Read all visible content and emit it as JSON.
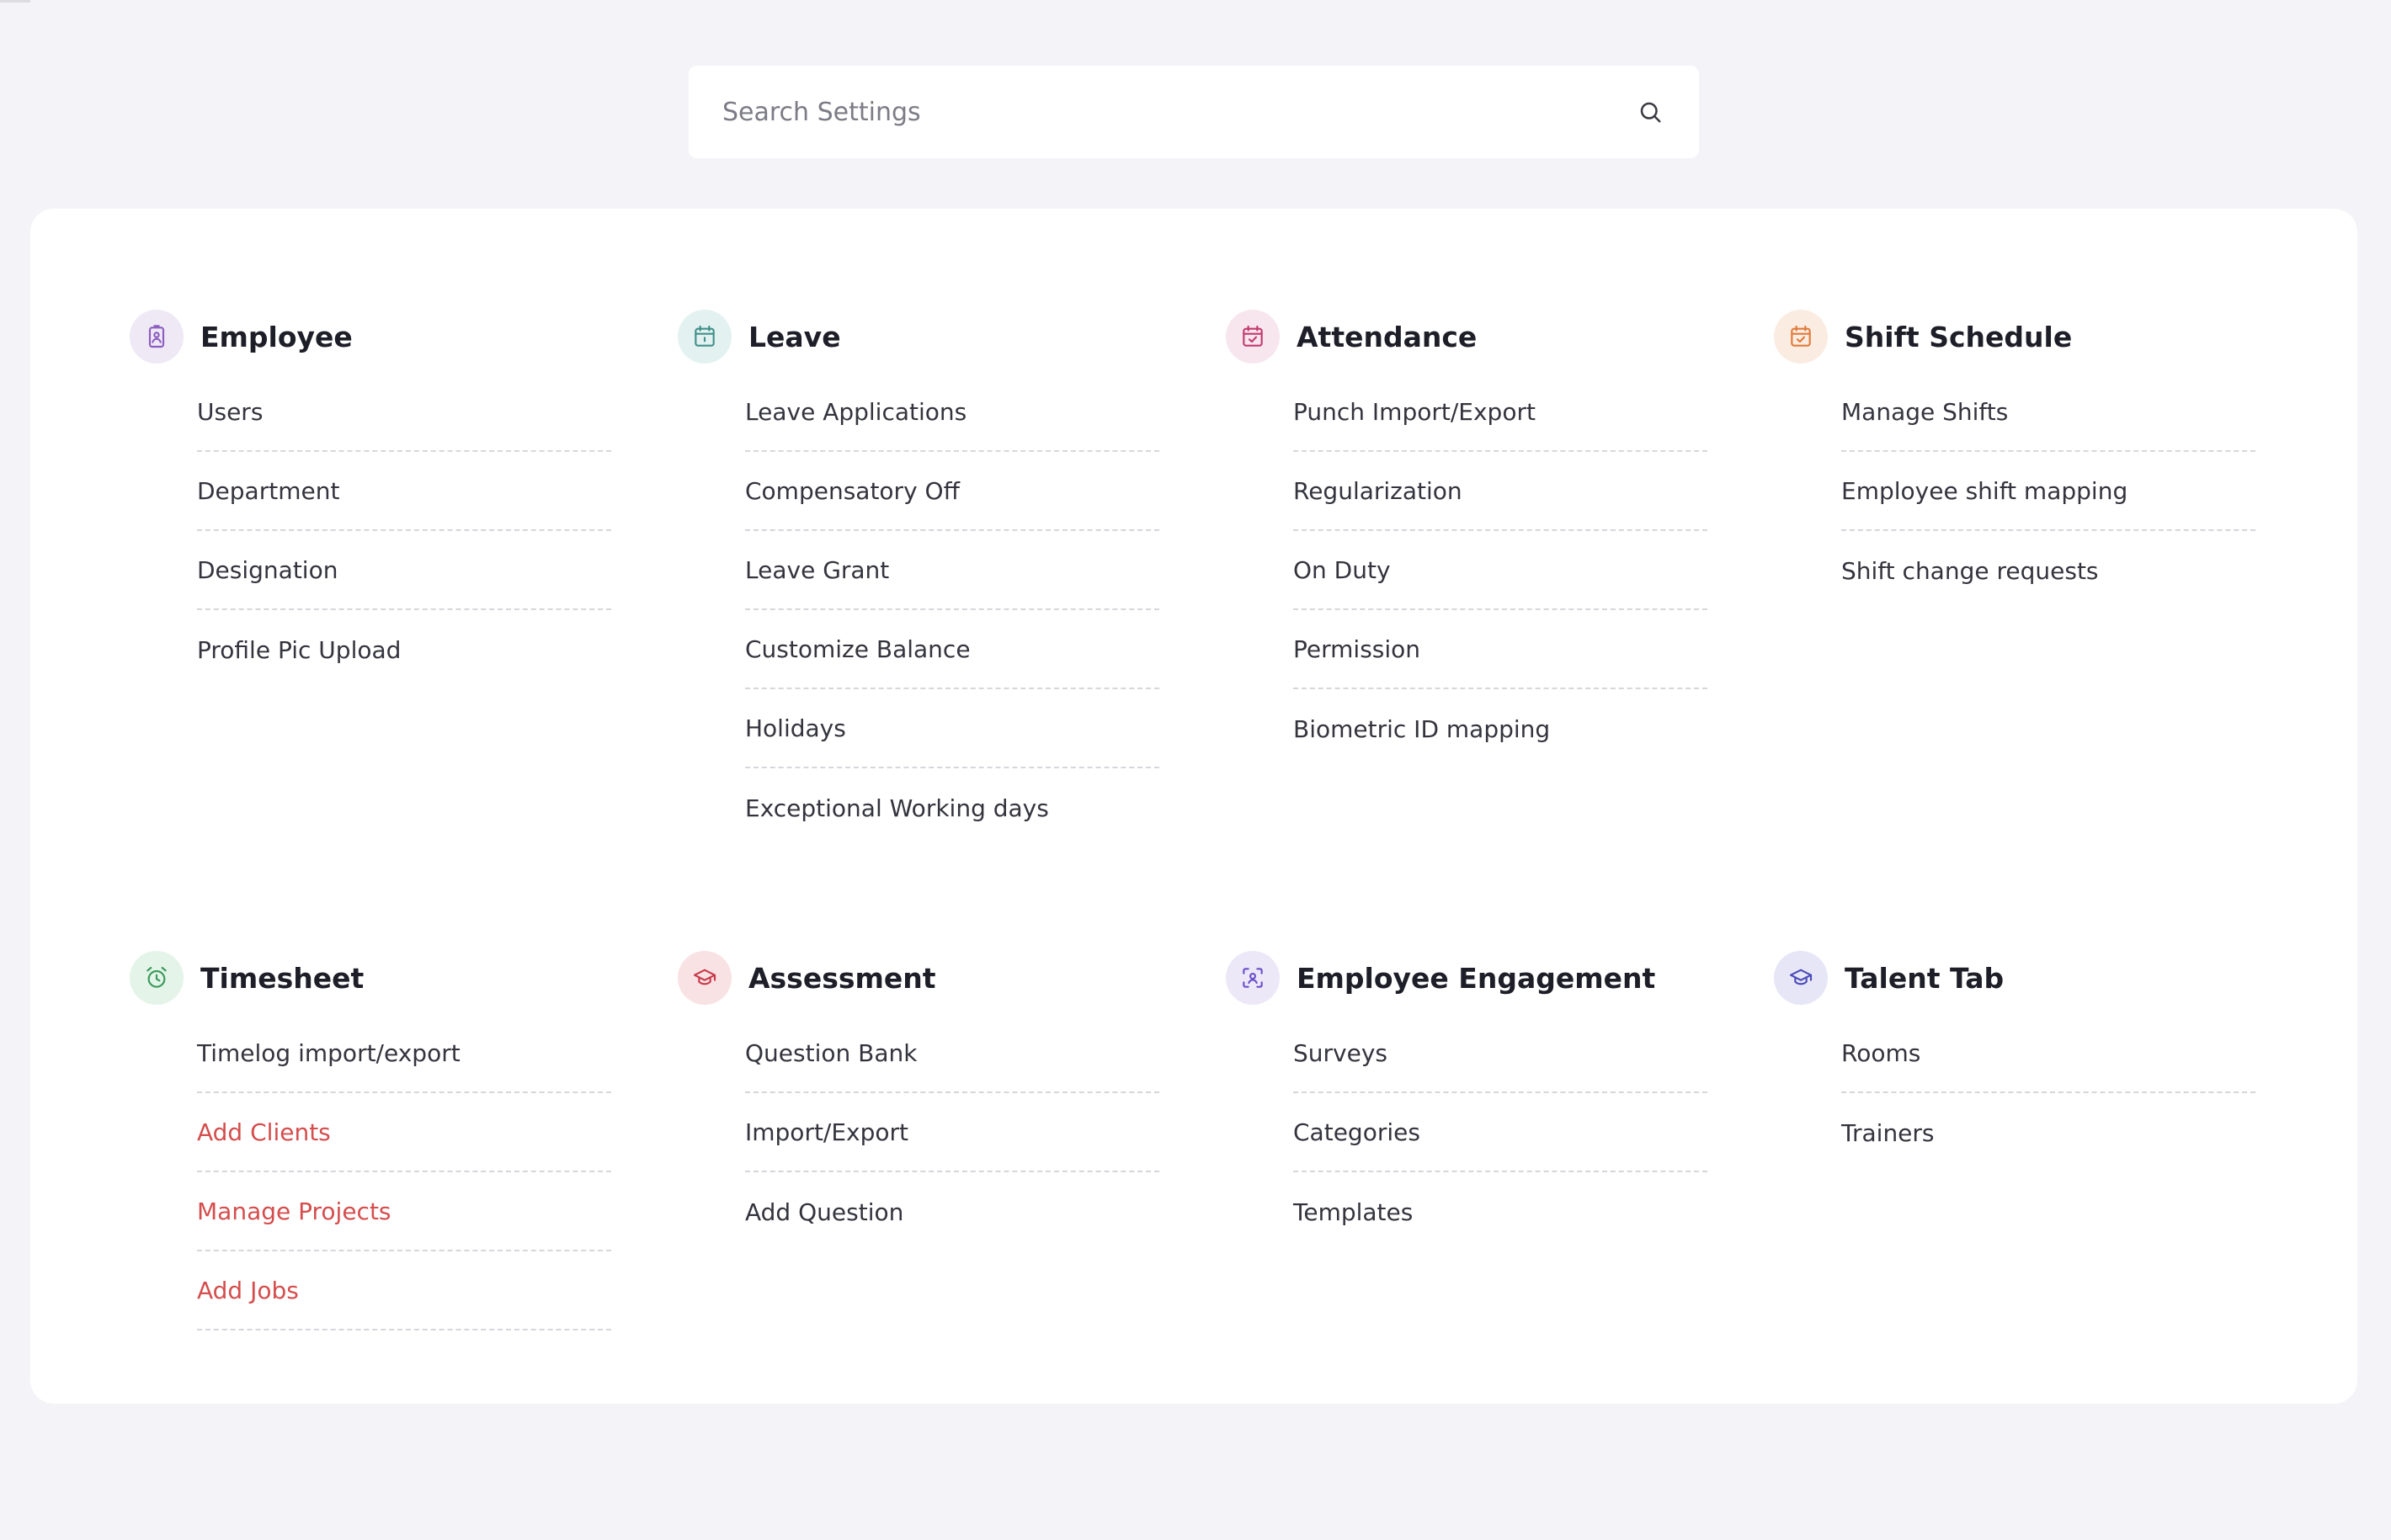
{
  "search": {
    "placeholder": "Search Settings",
    "value": ""
  },
  "sections": [
    {
      "title": "Employee",
      "icon": "id-badge-icon",
      "color": "#8a5cc0",
      "bg": "#efe8f5",
      "items": [
        "Users",
        "Department",
        "Designation",
        "Profile Pic Upload"
      ],
      "highlighted": []
    },
    {
      "title": "Leave",
      "icon": "calendar-icon",
      "color": "#3f8f8a",
      "bg": "#e3f2f0",
      "items": [
        "Leave Applications",
        "Compensatory Off",
        "Leave Grant",
        "Customize Balance",
        "Holidays",
        "Exceptional Working days"
      ],
      "highlighted": []
    },
    {
      "title": "Attendance",
      "icon": "calendar-check-icon",
      "color": "#c23a6e",
      "bg": "#f7e6ee",
      "items": [
        "Punch Import/Export",
        "Regularization",
        "On Duty",
        "Permission",
        "Biometric ID mapping"
      ],
      "highlighted": []
    },
    {
      "title": "Shift Schedule",
      "icon": "calendar-shift-icon",
      "color": "#e07a3a",
      "bg": "#fbece1",
      "items": [
        "Manage Shifts",
        "Employee shift mapping",
        "Shift change requests"
      ],
      "highlighted": []
    },
    {
      "title": "Timesheet",
      "icon": "alarm-clock-icon",
      "color": "#3a9a5a",
      "bg": "#e4f4e9",
      "items": [
        "Timelog import/export",
        "Add Clients",
        "Manage Projects",
        "Add Jobs"
      ],
      "highlighted": [
        1,
        2,
        3
      ]
    },
    {
      "title": "Assessment",
      "icon": "graduation-cap-icon",
      "color": "#c73a4a",
      "bg": "#f9e2e4",
      "items": [
        "Question Bank",
        "Import/Export",
        "Add Question"
      ],
      "highlighted": []
    },
    {
      "title": "Employee Engagement",
      "icon": "face-scan-icon",
      "color": "#6a4fc8",
      "bg": "#ece8f8",
      "items": [
        "Surveys",
        "Categories",
        "Templates"
      ],
      "highlighted": []
    },
    {
      "title": "Talent Tab",
      "icon": "mortarboard-icon",
      "color": "#4a4ab8",
      "bg": "#e6e6f7",
      "items": [
        "Rooms",
        "Trainers"
      ],
      "highlighted": []
    }
  ]
}
